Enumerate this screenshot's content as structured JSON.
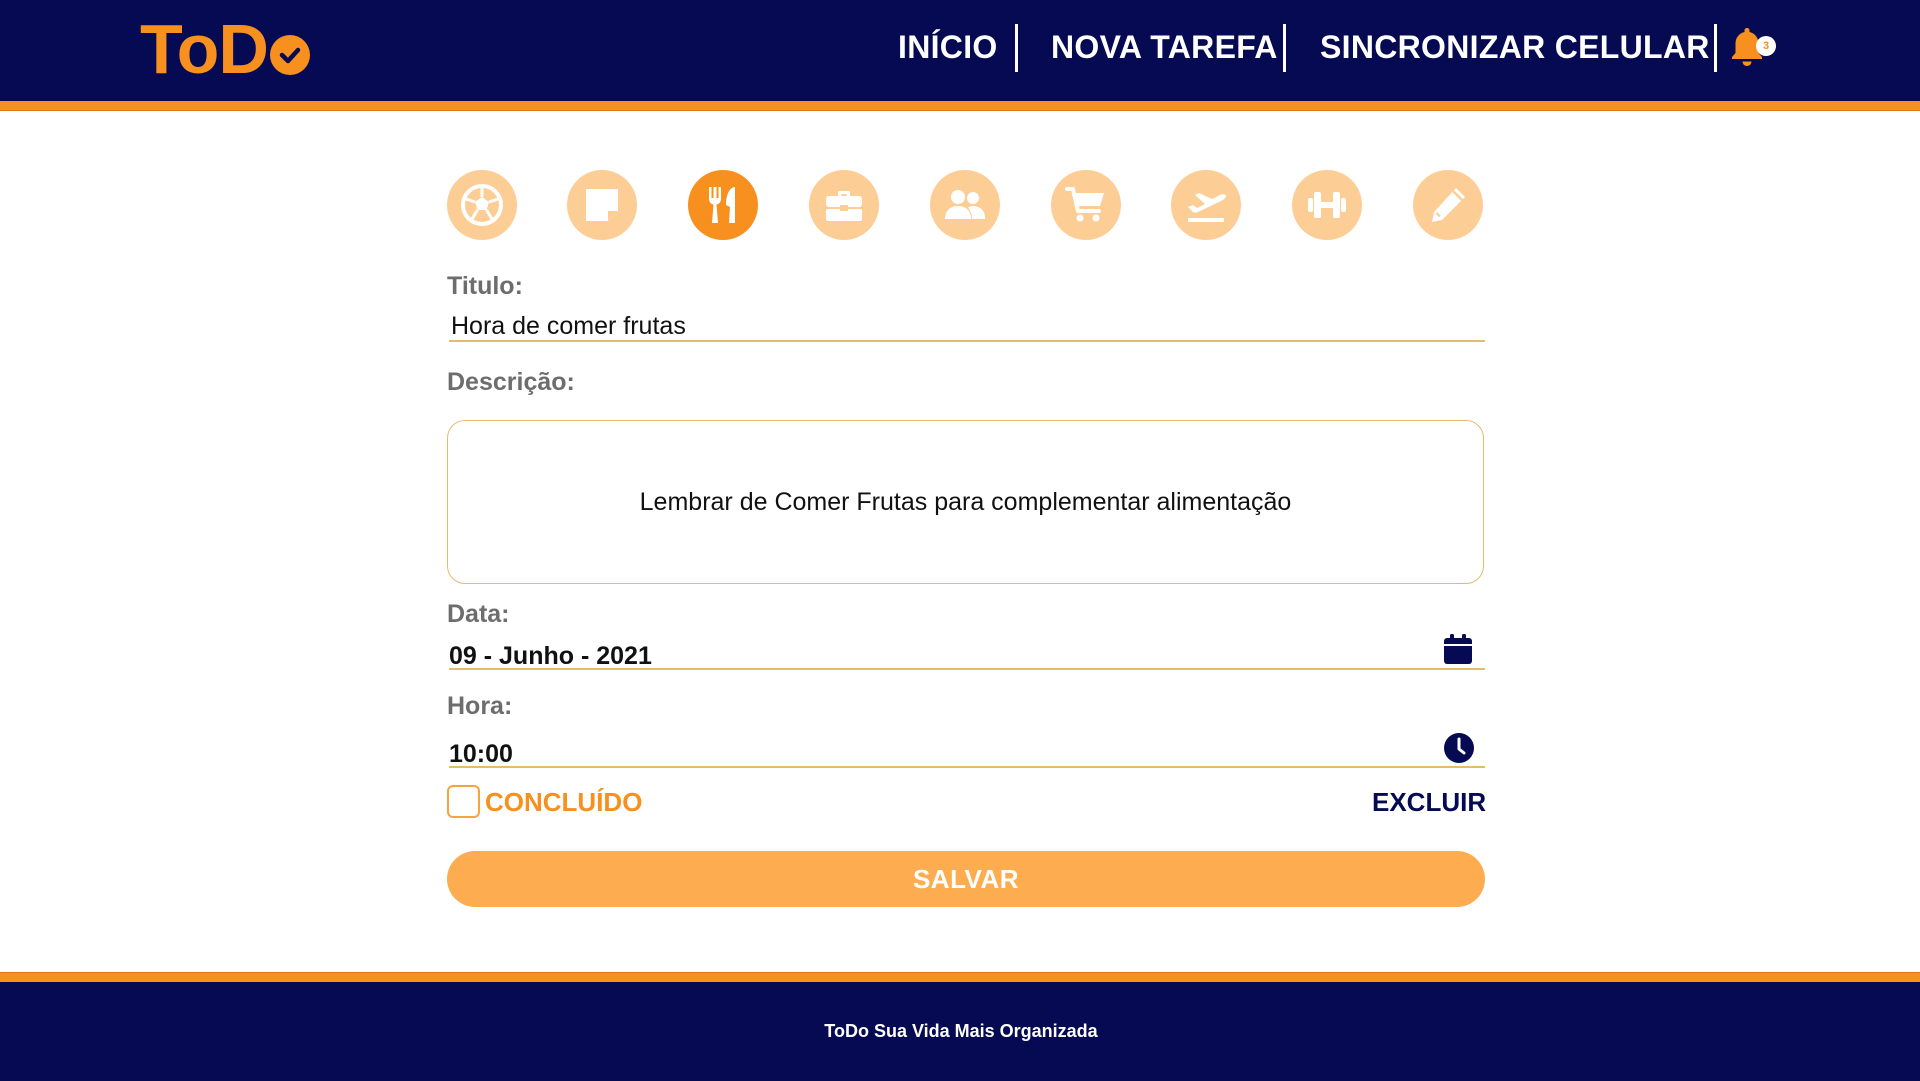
{
  "header": {
    "logo_text": "ToD",
    "nav": {
      "inicio": "INÍCIO",
      "nova_tarefa": "NOVA TAREFA",
      "sincronizar": "SINCRONIZAR CELULAR"
    },
    "notification_count": "3"
  },
  "colors": {
    "navy": "#050a52",
    "orange": "#f7901e",
    "light_orange": "#fdcd96",
    "button_orange": "#fdad50"
  },
  "categories": [
    {
      "icon": "soccer-ball-icon",
      "active": false
    },
    {
      "icon": "note-icon",
      "active": false
    },
    {
      "icon": "fork-knife-icon",
      "active": true
    },
    {
      "icon": "briefcase-icon",
      "active": false
    },
    {
      "icon": "users-icon",
      "active": false
    },
    {
      "icon": "cart-icon",
      "active": false
    },
    {
      "icon": "plane-departure-icon",
      "active": false
    },
    {
      "icon": "dumbbell-icon",
      "active": false
    },
    {
      "icon": "pencil-icon",
      "active": false
    }
  ],
  "form": {
    "titulo_label": "Titulo:",
    "titulo_value": "Hora de comer frutas",
    "descricao_label": "Descrição:",
    "descricao_value": "Lembrar de Comer Frutas para complementar alimentação",
    "data_label": "Data:",
    "data_value": "09 - Junho - 2021",
    "hora_label": "Hora:",
    "hora_value": "10:00",
    "concluido_label": "CONCLUÍDO",
    "concluido_checked": false,
    "excluir_label": "EXCLUIR",
    "salvar_label": "SALVAR"
  },
  "footer": {
    "text": "ToDo Sua Vida Mais Organizada"
  }
}
